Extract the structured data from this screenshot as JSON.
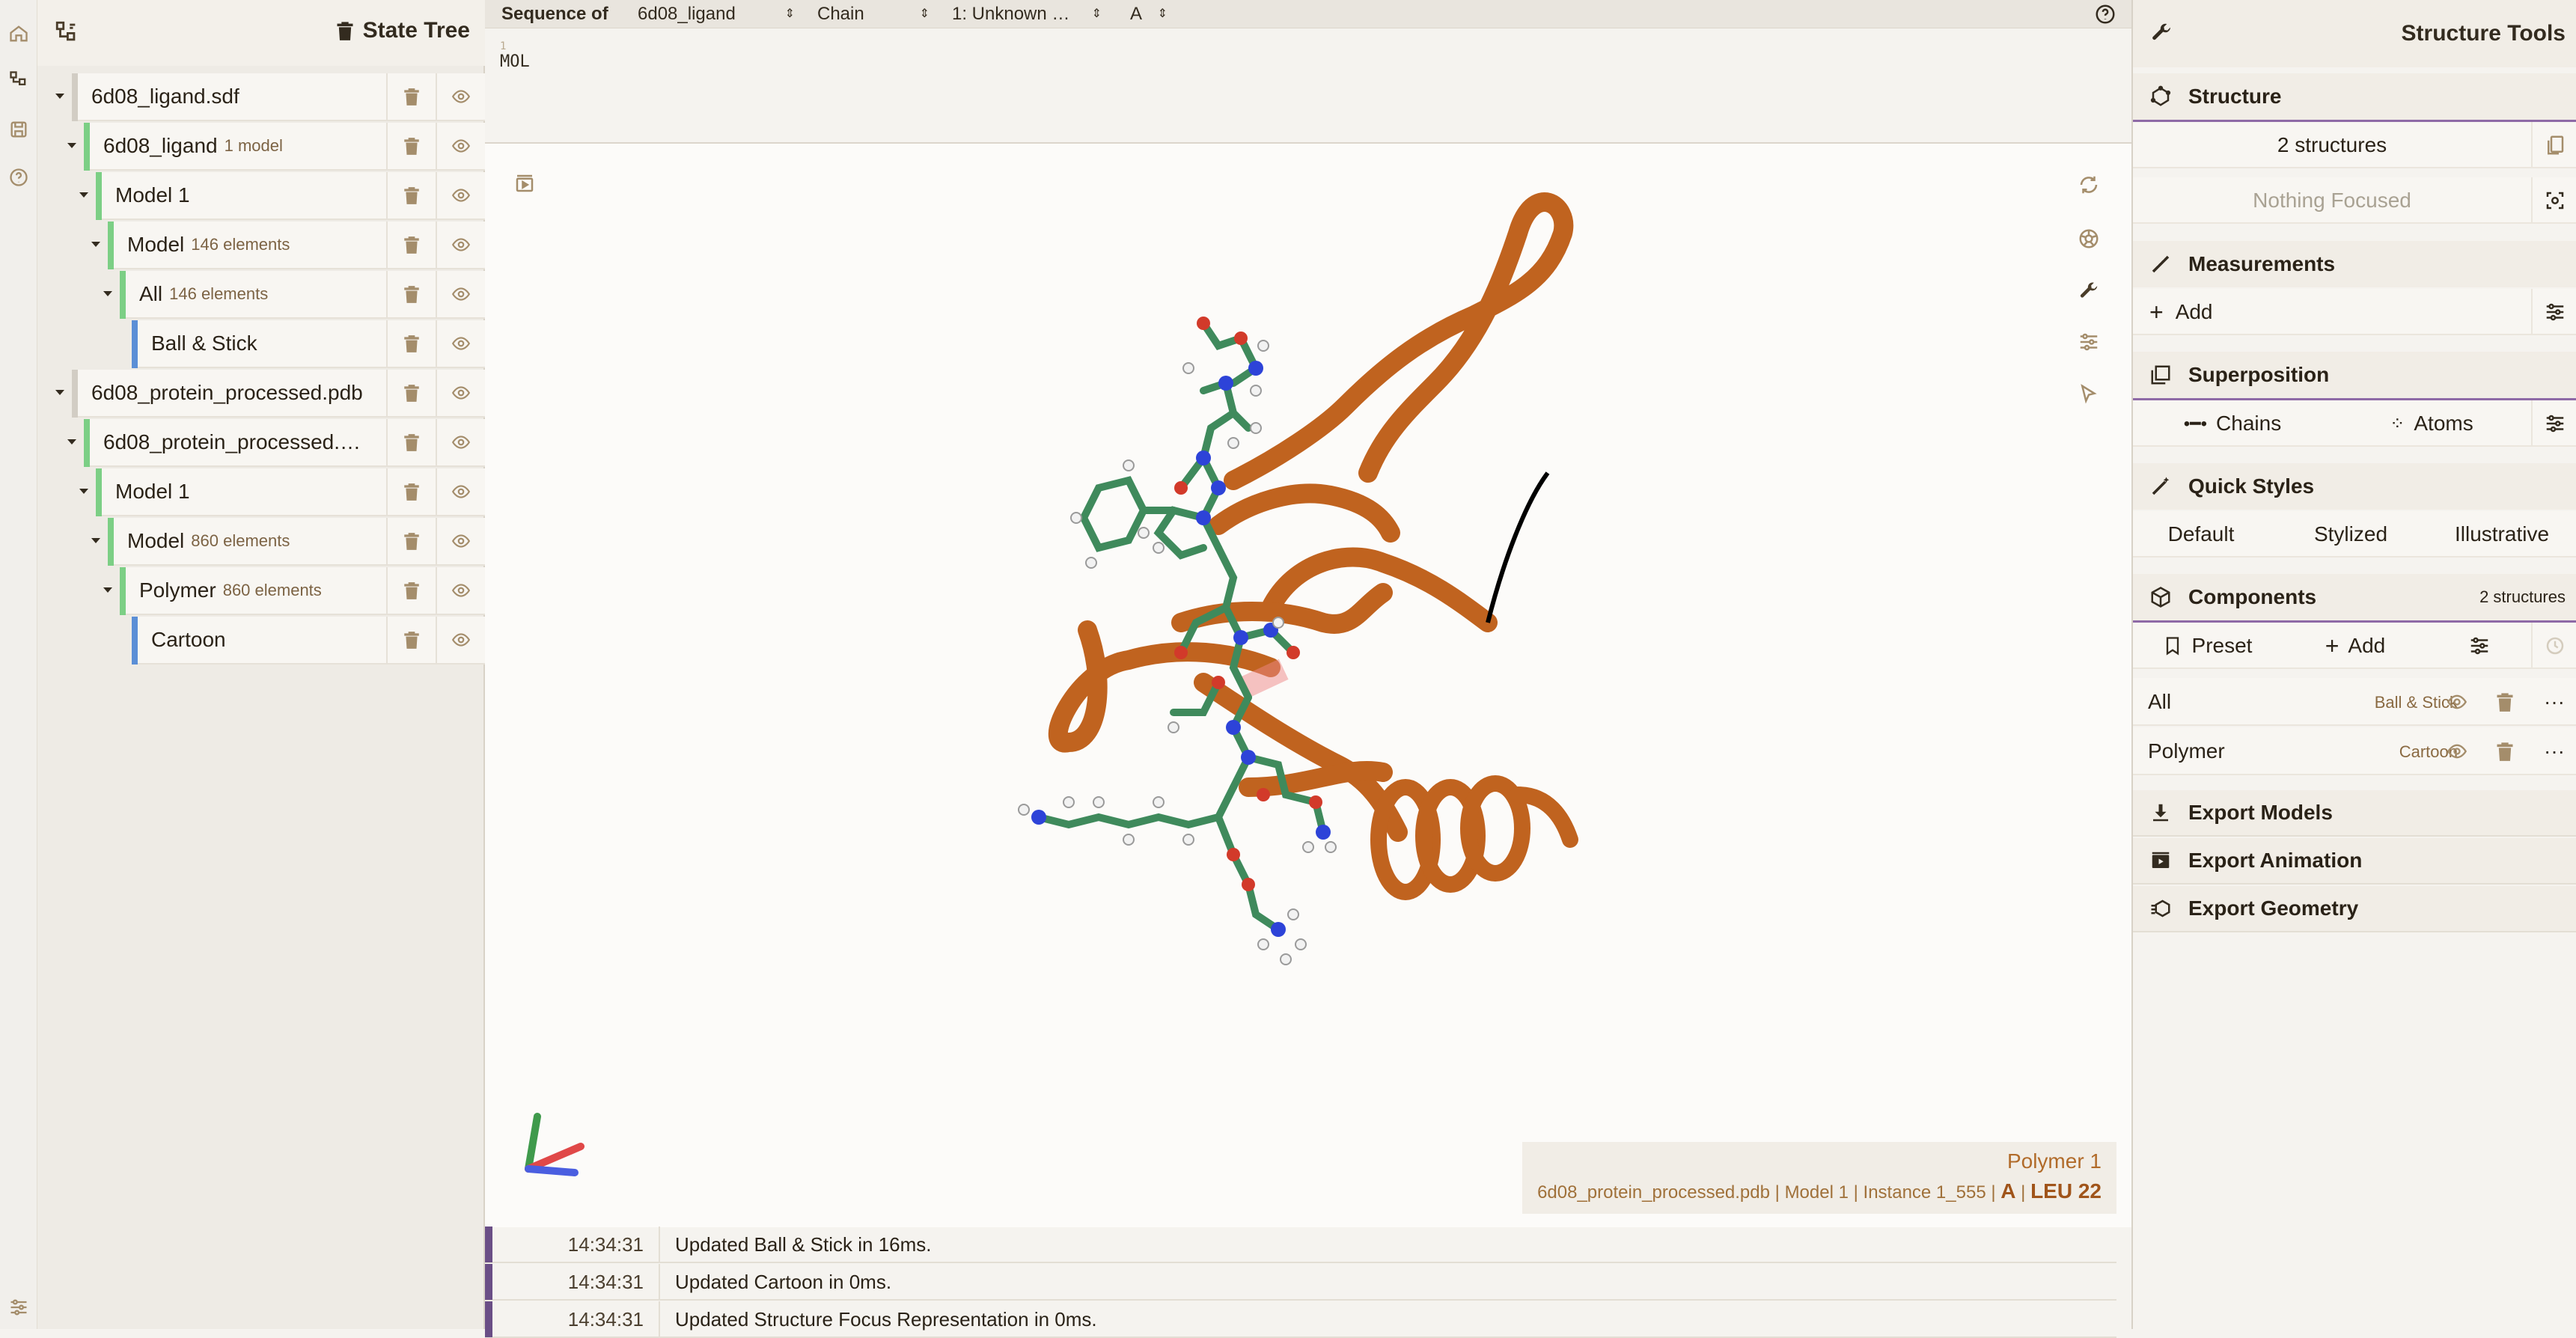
{
  "rail": {
    "icons": [
      "home-icon",
      "tree-icon",
      "save-icon",
      "help-icon",
      "settings-icon"
    ]
  },
  "state_tree": {
    "title": "State Tree",
    "rows": [
      {
        "label": "6d08_ligand.sdf",
        "sub": ""
      },
      {
        "label": "6d08_ligand",
        "sub": "1 model"
      },
      {
        "label": "Model 1",
        "sub": ""
      },
      {
        "label": "Model",
        "sub": "146 elements"
      },
      {
        "label": "All",
        "sub": "146 elements"
      },
      {
        "label": "Ball & Stick",
        "sub": ""
      },
      {
        "label": "6d08_protein_processed.pdb",
        "sub": ""
      },
      {
        "label": "6d08_protein_processed.…",
        "sub": ""
      },
      {
        "label": "Model 1",
        "sub": ""
      },
      {
        "label": "Model",
        "sub": "860 elements"
      },
      {
        "label": "Polymer",
        "sub": "860 elements"
      },
      {
        "label": "Cartoon",
        "sub": ""
      }
    ]
  },
  "sequence": {
    "label": "Sequence of",
    "structure": "6d08_ligand",
    "mode": "Chain",
    "entity": "1: Unknown …",
    "chain": "A",
    "index": "1",
    "residues": "MOL"
  },
  "viewport": {
    "colors": {
      "cartoon": "#c0631f",
      "carbon": "#3f8a5c",
      "nitrogen": "#2d43d8",
      "oxygen": "#d23a2a",
      "hydrogen": "#f2f2f2"
    }
  },
  "hover": {
    "title": "Polymer 1",
    "file": "6d08_protein_processed.pdb",
    "model": "Model 1",
    "instance": "Instance 1_555",
    "chain": "A",
    "residue": "LEU 22"
  },
  "log": [
    {
      "time": "14:34:31",
      "message": "Updated Ball & Stick in 16ms."
    },
    {
      "time": "14:34:31",
      "message": "Updated Cartoon in 0ms."
    },
    {
      "time": "14:34:31",
      "message": "Updated Structure Focus Representation in 0ms."
    }
  ],
  "structure_tools": {
    "title": "Structure Tools",
    "structure": {
      "title": "Structure",
      "count_label": "2 structures",
      "focus_label": "Nothing Focused"
    },
    "measurements": {
      "title": "Measurements",
      "add_label": "Add"
    },
    "superposition": {
      "title": "Superposition",
      "chains_label": "Chains",
      "atoms_label": "Atoms"
    },
    "quick_styles": {
      "title": "Quick Styles",
      "options": [
        "Default",
        "Stylized",
        "Illustrative"
      ]
    },
    "components": {
      "title": "Components",
      "count_label": "2 structures",
      "preset_label": "Preset",
      "add_label": "Add",
      "items": [
        {
          "name": "All",
          "repr": "Ball & Stick"
        },
        {
          "name": "Polymer",
          "repr": "Cartoon"
        }
      ]
    },
    "exports": [
      "Export Models",
      "Export Animation",
      "Export Geometry"
    ]
  }
}
